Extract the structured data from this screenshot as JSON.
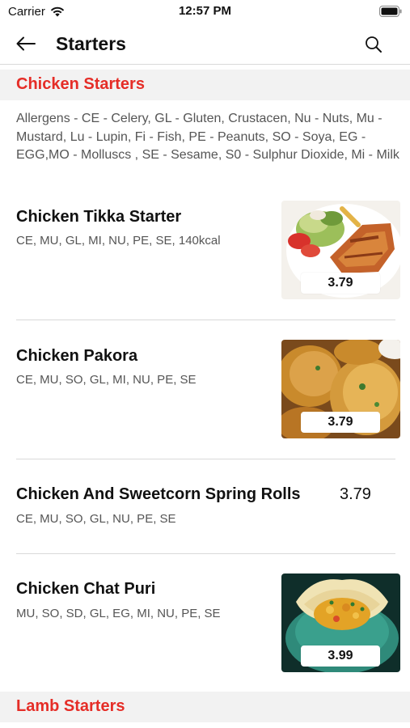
{
  "status": {
    "carrier": "Carrier",
    "time": "12:57 PM"
  },
  "nav": {
    "title": "Starters"
  },
  "sections": [
    {
      "title": "Chicken Starters"
    },
    {
      "title": "Lamb Starters"
    }
  ],
  "allergens": "Allergens - CE - Celery, GL - Gluten, Crustacen, Nu - Nuts, Mu - Mustard, Lu - Lupin, Fi - Fish, PE - Peanuts, SO - Soya, EG - EGG,MO - Molluscs , SE - Sesame, S0 - Sulphur Dioxide, Mi - Milk",
  "items": [
    {
      "name": "Chicken Tikka Starter",
      "description": "CE, MU, GL, MI, NU, PE, SE, 140kcal",
      "price": "3.79",
      "image": "grilled-chicken-salad"
    },
    {
      "name": "Chicken Pakora",
      "description": "CE, MU, SO, GL, MI, NU, PE, SE",
      "price": "3.79",
      "image": "fried-pakora"
    },
    {
      "name": "Chicken And Sweetcorn Spring Rolls",
      "description": "CE, MU, SO, GL, NU, PE, SE",
      "price": "3.79"
    },
    {
      "name": "Chicken Chat Puri",
      "description": "MU, SO, SD, GL, EG, MI, NU, PE, SE",
      "price": "3.99",
      "image": "chat-puri-bowl"
    }
  ],
  "colors": {
    "accent": "#e52d27",
    "section_bg": "#f2f2f2",
    "divider": "#d9d9d9"
  }
}
